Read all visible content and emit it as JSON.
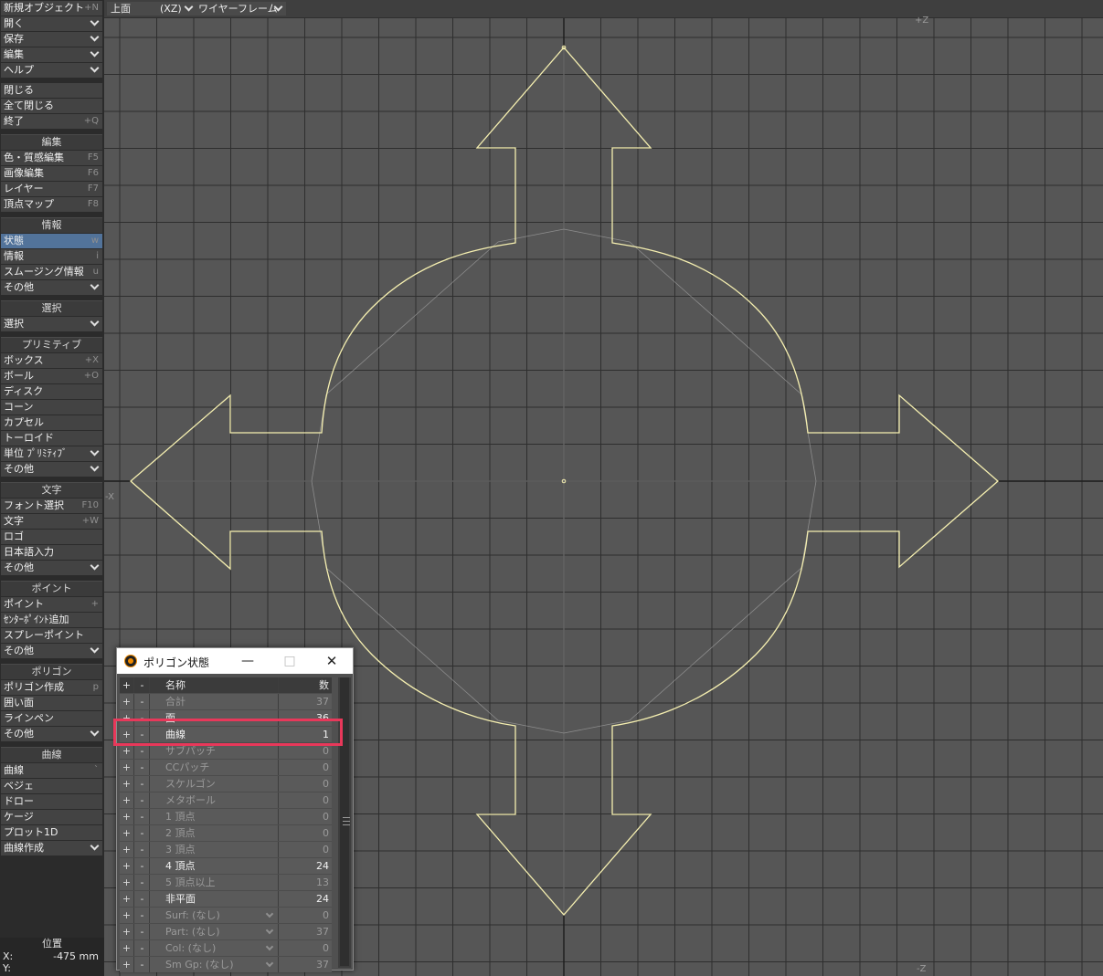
{
  "toolbar": {
    "groups": [
      {
        "header": "",
        "items": [
          {
            "label": "新規オブジェクト",
            "shortcut": "+N",
            "dropdown": false
          },
          {
            "label": "開く",
            "shortcut": "",
            "dropdown": true
          },
          {
            "label": "保存",
            "shortcut": "",
            "dropdown": true
          },
          {
            "label": "編集",
            "shortcut": "",
            "dropdown": true
          },
          {
            "label": "ヘルプ",
            "shortcut": "",
            "dropdown": true
          }
        ]
      },
      {
        "header": "",
        "items": [
          {
            "label": "閉じる",
            "shortcut": "",
            "dropdown": false
          },
          {
            "label": "全て閉じる",
            "shortcut": "",
            "dropdown": false
          },
          {
            "label": "終了",
            "shortcut": "+Q",
            "dropdown": false
          }
        ]
      },
      {
        "header": "編集",
        "items": [
          {
            "label": "色・質感編集",
            "shortcut": "F5",
            "dropdown": false
          },
          {
            "label": "画像編集",
            "shortcut": "F6",
            "dropdown": false
          },
          {
            "label": "レイヤー",
            "shortcut": "F7",
            "dropdown": false
          },
          {
            "label": "頂点マップ",
            "shortcut": "F8",
            "dropdown": false
          }
        ]
      },
      {
        "header": "情報",
        "items": [
          {
            "label": "状態",
            "shortcut": "w",
            "dropdown": false,
            "active": true
          },
          {
            "label": "情報",
            "shortcut": "i",
            "dropdown": false
          },
          {
            "label": "スムージング情報",
            "shortcut": "u",
            "dropdown": false
          },
          {
            "label": "その他",
            "shortcut": "",
            "dropdown": true
          }
        ]
      },
      {
        "header": "選択",
        "items": [
          {
            "label": "選択",
            "shortcut": "",
            "dropdown": true
          }
        ]
      },
      {
        "header": "プリミティブ",
        "items": [
          {
            "label": "ボックス",
            "shortcut": "+X",
            "dropdown": false
          },
          {
            "label": "ボール",
            "shortcut": "+O",
            "dropdown": false
          },
          {
            "label": "ディスク",
            "shortcut": "",
            "dropdown": false
          },
          {
            "label": "コーン",
            "shortcut": "",
            "dropdown": false
          },
          {
            "label": "カプセル",
            "shortcut": "",
            "dropdown": false
          },
          {
            "label": "トーロイド",
            "shortcut": "",
            "dropdown": false
          },
          {
            "label": "単位 ﾌﾟﾘﾐﾃｨﾌﾞ",
            "shortcut": "",
            "dropdown": true
          },
          {
            "label": "その他",
            "shortcut": "",
            "dropdown": true
          }
        ]
      },
      {
        "header": "文字",
        "items": [
          {
            "label": "フォント選択",
            "shortcut": "F10",
            "dropdown": false
          },
          {
            "label": "文字",
            "shortcut": "+W",
            "dropdown": false
          },
          {
            "label": "ロゴ",
            "shortcut": "",
            "dropdown": false
          },
          {
            "label": "日本語入力",
            "shortcut": "",
            "dropdown": false
          },
          {
            "label": "その他",
            "shortcut": "",
            "dropdown": true
          }
        ]
      },
      {
        "header": "ポイント",
        "items": [
          {
            "label": "ポイント",
            "shortcut": "+",
            "dropdown": false
          },
          {
            "label": "ｾﾝﾀｰﾎﾟｲﾝﾄ追加",
            "shortcut": "",
            "dropdown": false
          },
          {
            "label": "スプレーポイント",
            "shortcut": "",
            "dropdown": false
          },
          {
            "label": "その他",
            "shortcut": "",
            "dropdown": true
          }
        ]
      },
      {
        "header": "ポリゴン",
        "items": [
          {
            "label": "ポリゴン作成",
            "shortcut": "p",
            "dropdown": false
          },
          {
            "label": "囲い面",
            "shortcut": "",
            "dropdown": false
          },
          {
            "label": "ラインペン",
            "shortcut": "",
            "dropdown": false
          },
          {
            "label": "その他",
            "shortcut": "",
            "dropdown": true
          }
        ]
      },
      {
        "header": "曲線",
        "items": [
          {
            "label": "曲線",
            "shortcut": "`",
            "dropdown": false
          },
          {
            "label": "ベジェ",
            "shortcut": "",
            "dropdown": false
          },
          {
            "label": "ドロー",
            "shortcut": "",
            "dropdown": false
          },
          {
            "label": "ケージ",
            "shortcut": "",
            "dropdown": false
          },
          {
            "label": "プロット1D",
            "shortcut": "",
            "dropdown": false
          },
          {
            "label": "曲線作成",
            "shortcut": "",
            "dropdown": true
          }
        ]
      }
    ]
  },
  "position_panel": {
    "title": "位置",
    "x_label": "X:",
    "x_value": "-475 mm",
    "y_label": "Y:",
    "y_value": ""
  },
  "viewport": {
    "view_name": "上面",
    "view_axis": "(XZ)",
    "render_mode": "ワイヤーフレーム",
    "axis_labels": {
      "top": "+Z",
      "bottom": "-Z",
      "left": "-X"
    },
    "colors": {
      "background": "#565656",
      "grid": "#2e2e2e",
      "axis": "#1c1c1c",
      "curve": "#f5efb0",
      "guide": "#9a9a9a"
    }
  },
  "polygon_stats": {
    "title": "ポリゴン状態",
    "columns": {
      "plus": "+",
      "minus": "-",
      "name": "名称",
      "count": "数"
    },
    "rows": [
      {
        "name": "合計",
        "count": "37",
        "enabled": false
      },
      {
        "name": "面",
        "count": "36",
        "enabled": true
      },
      {
        "name": "曲線",
        "count": "1",
        "enabled": true,
        "highlighted": true
      },
      {
        "name": "サブパッチ",
        "count": "0",
        "enabled": false
      },
      {
        "name": "CCパッチ",
        "count": "0",
        "enabled": false
      },
      {
        "name": "スケルゴン",
        "count": "0",
        "enabled": false
      },
      {
        "name": "メタボール",
        "count": "0",
        "enabled": false
      },
      {
        "name": "1 頂点",
        "count": "0",
        "enabled": false
      },
      {
        "name": "2 頂点",
        "count": "0",
        "enabled": false
      },
      {
        "name": "3 頂点",
        "count": "0",
        "enabled": false
      },
      {
        "name": "4 頂点",
        "count": "24",
        "enabled": true
      },
      {
        "name": "5 頂点以上",
        "count": "13",
        "enabled": false
      },
      {
        "name": "非平面",
        "count": "24",
        "enabled": true
      },
      {
        "name": "Surf: (なし)",
        "count": "0",
        "enabled": false,
        "dropdown": true
      },
      {
        "name": "Part: (なし)",
        "count": "37",
        "enabled": false,
        "dropdown": true
      },
      {
        "name": "Col: (なし)",
        "count": "0",
        "enabled": false,
        "dropdown": true
      },
      {
        "name": "Sm Gp: (なし)",
        "count": "37",
        "enabled": false,
        "dropdown": true
      }
    ]
  }
}
